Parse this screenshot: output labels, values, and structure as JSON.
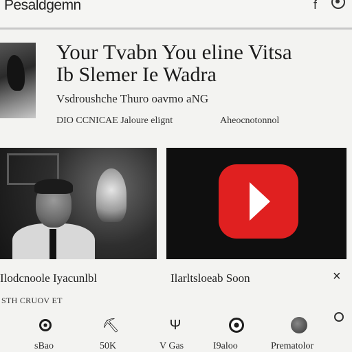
{
  "header": {
    "title": "Pesaldgemn",
    "icons": [
      "t-icon",
      "round-icon"
    ]
  },
  "video": {
    "title": "Your Tvabn You eline Vitsa",
    "subtitle": "Ib Slemer Ie Wadra",
    "channel": "Vsdroushche Thuro oavmo aNG",
    "stats": "DIO CCNICAE Jaloure elignt",
    "tag": "Aheocnotonnol"
  },
  "cards": [
    {
      "caption": "Ilodcnoole Iyacunlbl",
      "icon": "photo"
    },
    {
      "caption": "Ilarltsloeab Soon",
      "icon": "youtube-logo"
    }
  ],
  "close_label": "×",
  "section_label": "STH CRUOV ET",
  "nav": [
    {
      "label": "sBao",
      "icon": "record-icon",
      "glyph": ""
    },
    {
      "label": "50K",
      "icon": "tool-icon",
      "glyph": "⛏"
    },
    {
      "label": "V Gas",
      "icon": "flag-icon",
      "glyph": "Ψ"
    },
    {
      "label": "I9aloo",
      "icon": "target-icon",
      "glyph": ""
    },
    {
      "label": "Prematolor",
      "icon": "ball-icon",
      "glyph": ""
    },
    {
      "label": "",
      "icon": "small-circle-icon",
      "glyph": ""
    }
  ],
  "colors": {
    "background": "#f3f3f1",
    "youtube_red": "#e02020",
    "text": "#1e1e1e"
  }
}
